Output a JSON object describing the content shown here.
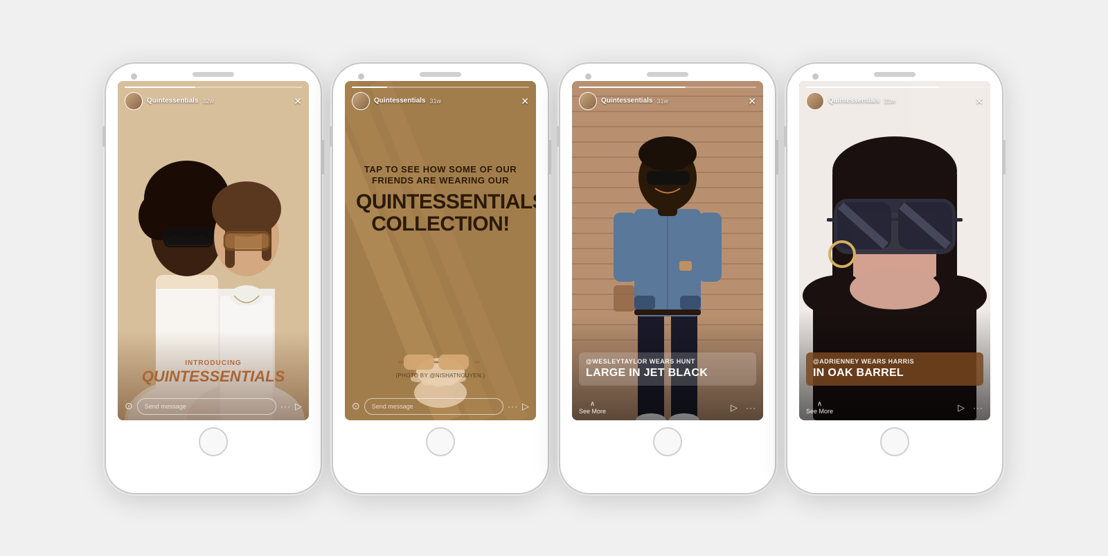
{
  "phones": [
    {
      "id": "phone1",
      "username": "Quintessentials",
      "time": "32w",
      "progress": 40,
      "caption_intro": "INTRODUCING",
      "caption_brand": "QUINTESSENTIALS",
      "bottom_type": "message",
      "message_placeholder": "Send message"
    },
    {
      "id": "phone2",
      "username": "Quintessentials",
      "time": "31w",
      "progress": 20,
      "tap_line1": "TAP TO SEE HOW SOME OF OUR",
      "tap_line2": "FRIENDS ARE WEARING OUR",
      "tap_brand": "QUINTESSENTIALS",
      "tap_collection": "COLLECTION!",
      "photo_credit": "(PHOTO BY @NISHATNCUYEN.)",
      "bottom_type": "message",
      "message_placeholder": "Send message"
    },
    {
      "id": "phone3",
      "username": "Quintessentials",
      "time": "31w",
      "progress": 60,
      "caption_sub": "@WESLEYTAYLOR WEARS HUNT",
      "caption_main": "LARGE IN JET BLACK",
      "bottom_type": "see-more",
      "see_more_label": "See More"
    },
    {
      "id": "phone4",
      "username": "Quintessentials",
      "time": "31w",
      "progress": 75,
      "caption_sub": "@ADRIENNEY WEARS HARRIS",
      "caption_main": "IN OAK BARREL",
      "bottom_type": "see-more",
      "see_more_label": "See More"
    }
  ],
  "icons": {
    "close": "✕",
    "camera": "⊙",
    "send": "▷",
    "dots": "···",
    "chevron_up": "∧"
  }
}
